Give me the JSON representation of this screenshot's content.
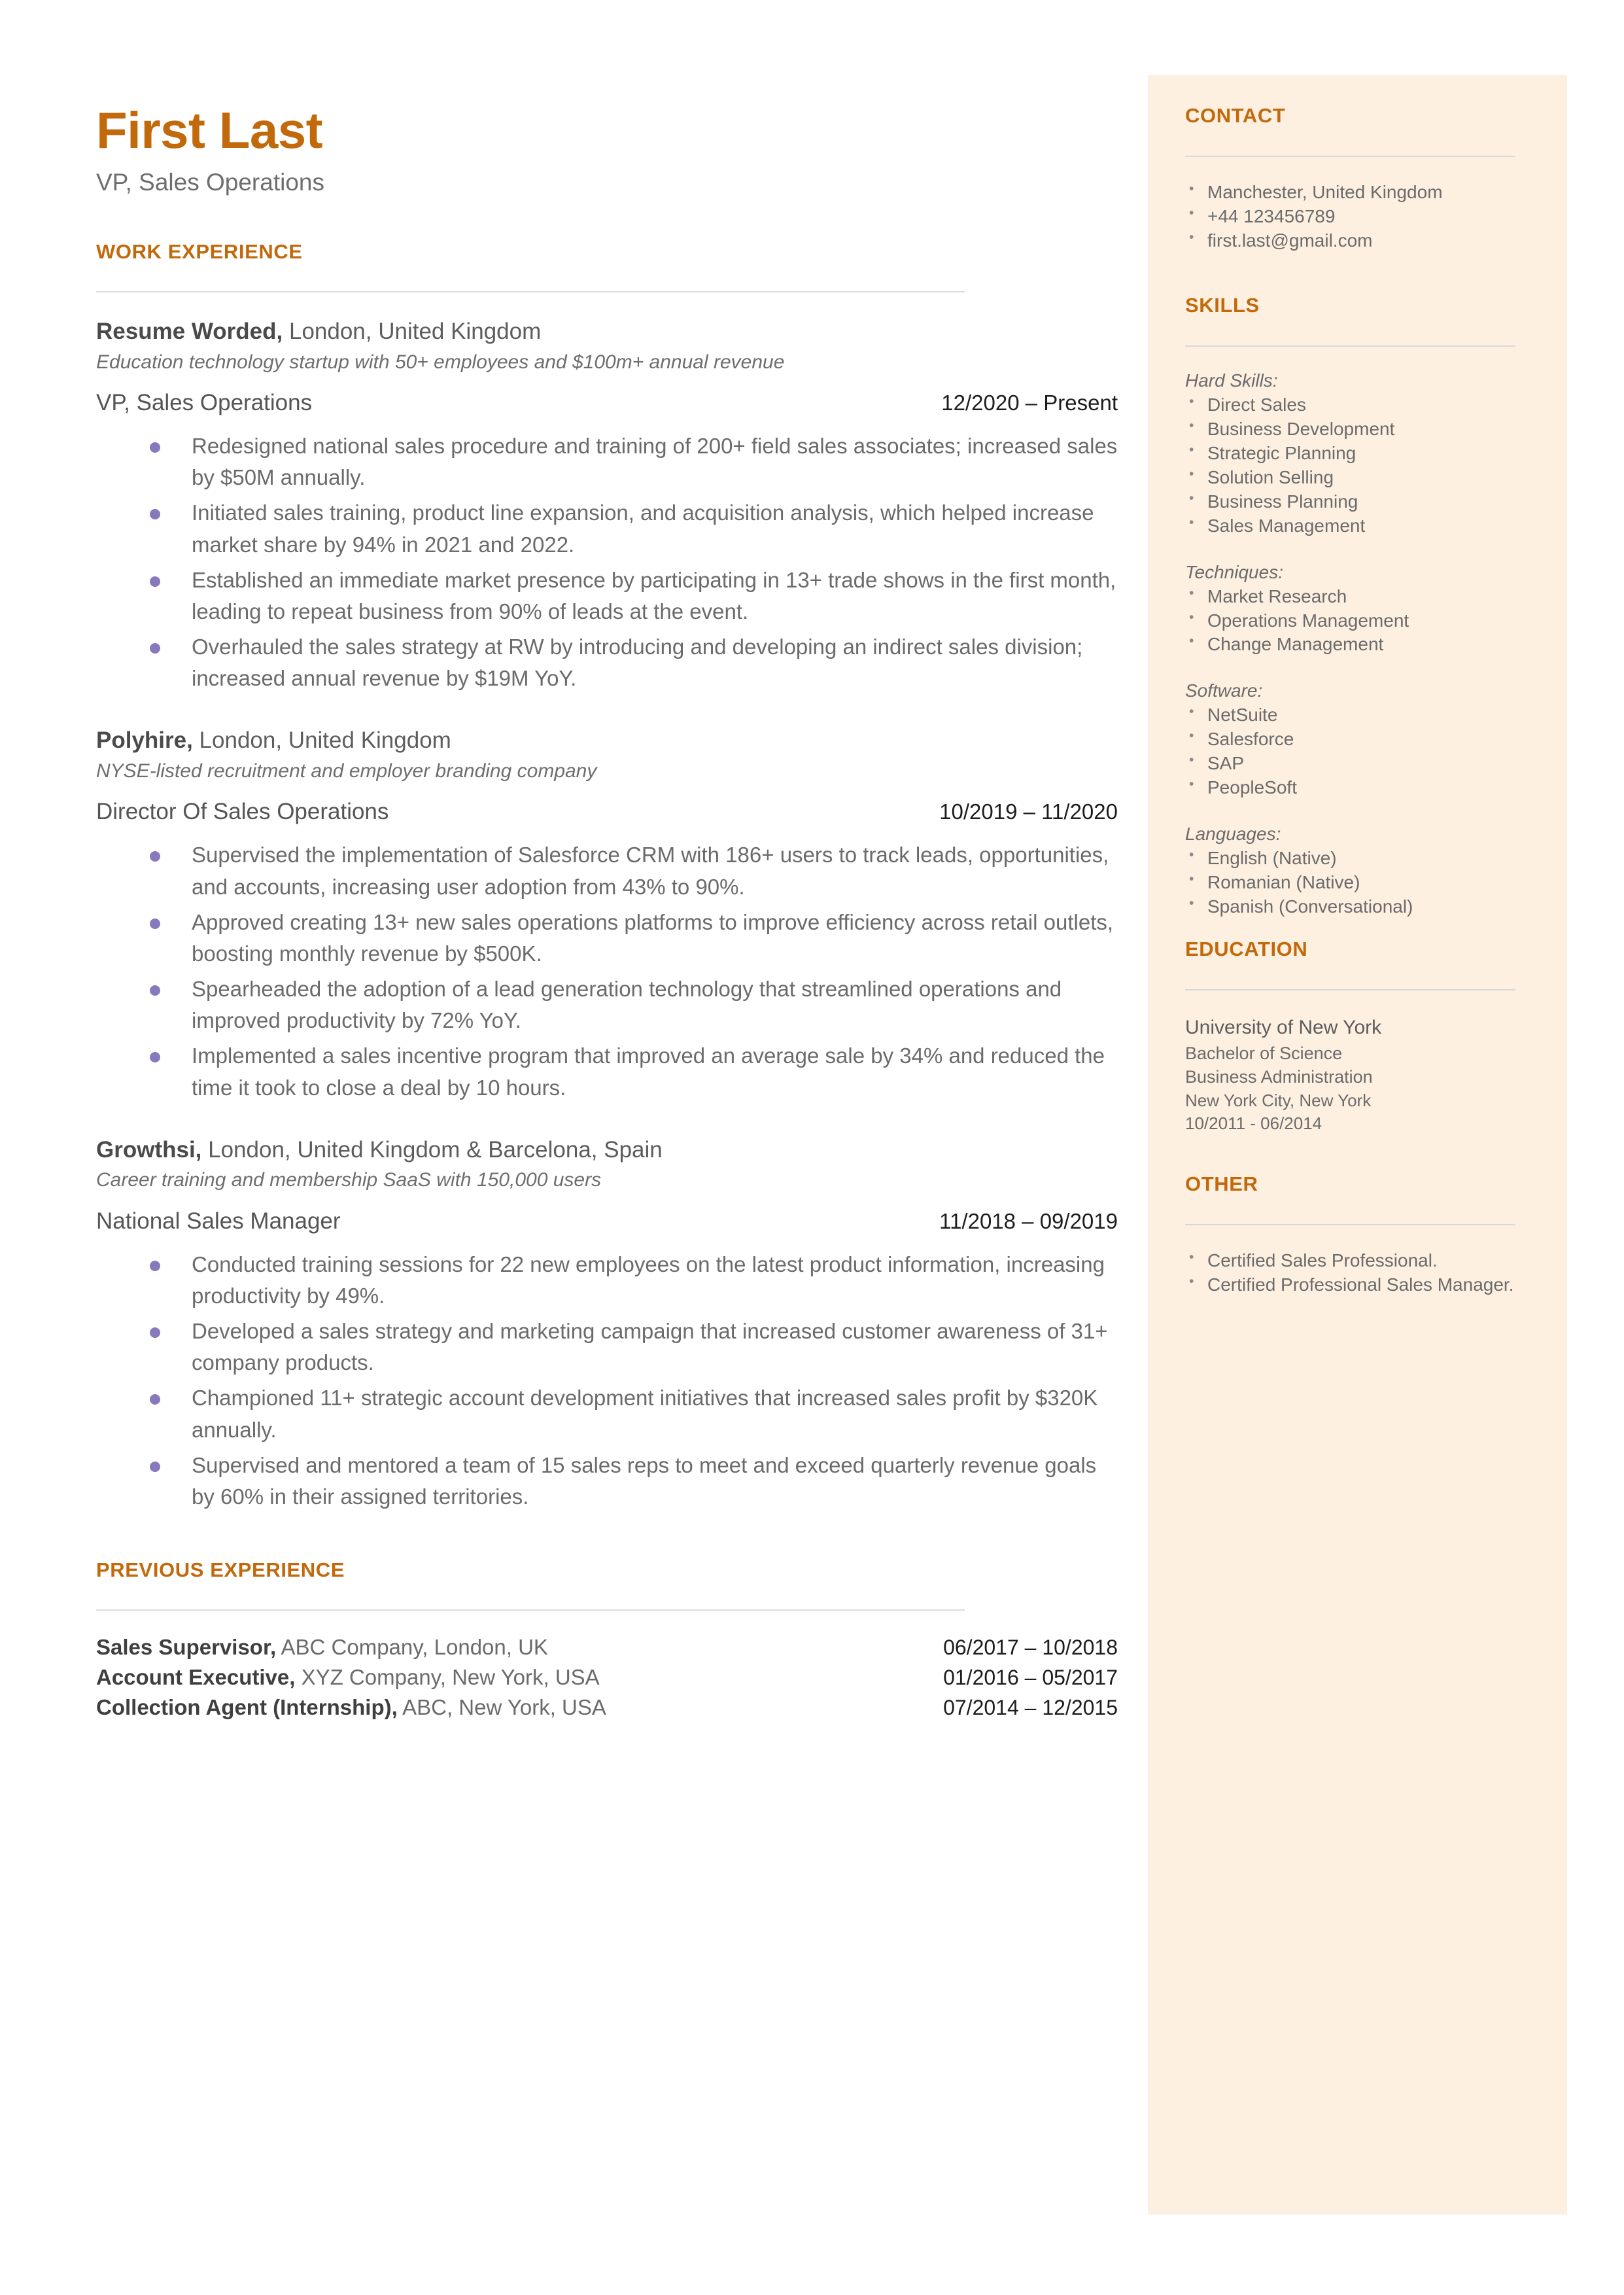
{
  "colors": {
    "accent": "#c2690b",
    "sidebar_bg": "#fdf0e1",
    "bullet": "#8879bd",
    "rule": "#dcdcdc"
  },
  "header": {
    "name": "First Last",
    "role": "VP, Sales Operations"
  },
  "main": {
    "work_experience_heading": "WORK EXPERIENCE",
    "previous_experience_heading": "PREVIOUS EXPERIENCE",
    "jobs": [
      {
        "company": "Resume Worded,",
        "location": " London, United Kingdom",
        "description": "Education technology startup with 50+ employees and $100m+ annual revenue",
        "title": "VP, Sales Operations",
        "dates": "12/2020 – Present",
        "bullets": [
          "Redesigned national sales procedure and training of 200+ field sales associates; increased sales by $50M annually.",
          "Initiated sales training, product line expansion, and acquisition analysis, which helped increase market share by 94% in 2021 and 2022.",
          "Established an immediate market presence by participating in 13+ trade shows in the first month, leading to repeat business from 90% of leads at the event.",
          "Overhauled the sales strategy at RW by introducing and developing an indirect sales division; increased annual revenue by $19M YoY."
        ]
      },
      {
        "company": "Polyhire,",
        "location": " London, United Kingdom",
        "description": "NYSE-listed recruitment and employer branding company",
        "title": "Director Of Sales Operations",
        "dates": "10/2019 – 11/2020",
        "bullets": [
          "Supervised the implementation of Salesforce CRM with 186+ users to track leads, opportunities, and accounts, increasing user adoption from 43% to 90%.",
          "Approved creating 13+ new sales operations platforms to improve efficiency across retail outlets, boosting monthly revenue by $500K.",
          "Spearheaded the adoption of a lead generation technology that streamlined operations and improved productivity by 72% YoY.",
          "Implemented a sales incentive program that improved an average sale by 34% and reduced the time it took to close a deal by 10 hours."
        ]
      },
      {
        "company": "Growthsi,",
        "location": " London, United Kingdom & Barcelona, Spain",
        "description": "Career training and membership SaaS with 150,000 users",
        "title": "National Sales Manager",
        "dates": "11/2018 – 09/2019",
        "bullets": [
          "Conducted training sessions for 22 new employees on the latest product information, increasing productivity by 49%.",
          "Developed a sales strategy and marketing campaign that increased customer awareness of 31+ company products.",
          "Championed 11+ strategic account development initiatives that increased sales profit by $320K annually.",
          "Supervised and mentored a team of 15 sales reps to meet and exceed quarterly revenue goals by 60% in their assigned territories."
        ]
      }
    ],
    "previous_experience": [
      {
        "title": "Sales Supervisor,",
        "detail": " ABC Company, London, UK",
        "dates": "06/2017 – 10/2018"
      },
      {
        "title": "Account Executive,",
        "detail": " XYZ Company, New York, USA",
        "dates": "01/2016 – 05/2017"
      },
      {
        "title": "Collection Agent (Internship),",
        "detail": " ABC, New York, USA",
        "dates": "07/2014 – 12/2015"
      }
    ]
  },
  "sidebar": {
    "contact": {
      "heading": "CONTACT",
      "items": [
        "Manchester, United Kingdom",
        "+44 123456789",
        "first.last@gmail.com"
      ]
    },
    "skills": {
      "heading": "SKILLS",
      "groups": [
        {
          "label": "Hard Skills:",
          "items": [
            "Direct Sales",
            "Business Development",
            "Strategic Planning",
            "Solution Selling",
            "Business Planning",
            "Sales Management"
          ]
        },
        {
          "label": "Techniques:",
          "items": [
            "Market Research",
            "Operations Management",
            "Change Management"
          ]
        },
        {
          "label": "Software:",
          "items": [
            "NetSuite",
            "Salesforce",
            "SAP",
            "PeopleSoft"
          ]
        },
        {
          "label": "Languages:",
          "items": [
            "English (Native)",
            "Romanian (Native)",
            "Spanish (Conversational)"
          ]
        }
      ]
    },
    "education": {
      "heading": "EDUCATION",
      "school": "University of New York",
      "degree": "Bachelor of Science",
      "field": "Business Administration",
      "location": "New York City, New York",
      "dates": "10/2011 - 06/2014"
    },
    "other": {
      "heading": "OTHER",
      "items": [
        "Certified Sales Professional.",
        "Certified Professional Sales Manager."
      ]
    }
  }
}
